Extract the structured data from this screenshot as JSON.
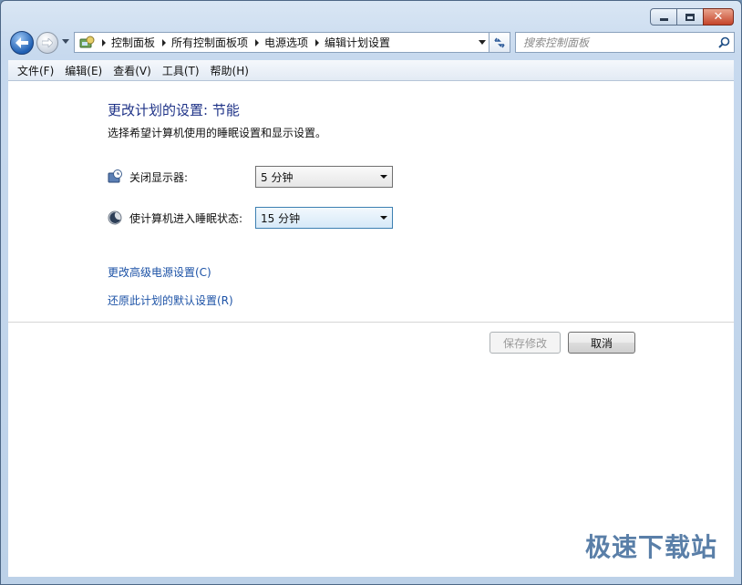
{
  "window": {
    "close_glyph": "✕"
  },
  "address_bar": {
    "breadcrumbs": [
      "控制面板",
      "所有控制面板项",
      "电源选项",
      "编辑计划设置"
    ],
    "icon": "control-panel-icon"
  },
  "search": {
    "placeholder": "搜索控制面板"
  },
  "menu": {
    "items": [
      "文件(F)",
      "编辑(E)",
      "查看(V)",
      "工具(T)",
      "帮助(H)"
    ]
  },
  "main": {
    "title": "更改计划的设置: 节能",
    "subtitle": "选择希望计算机使用的睡眠设置和显示设置。",
    "settings": [
      {
        "label": "关闭显示器:",
        "value": "5 分钟",
        "icon": "display-clock-icon"
      },
      {
        "label": "使计算机进入睡眠状态:",
        "value": "15 分钟",
        "icon": "sleep-moon-icon"
      }
    ],
    "links": {
      "advanced": "更改高级电源设置(C)",
      "restore": "还原此计划的默认设置(R)"
    },
    "buttons": {
      "save": "保存修改",
      "cancel": "取消"
    }
  },
  "watermark": "极速下载站",
  "colors": {
    "title": "#1e3287",
    "link": "#1c52a6",
    "frame": "#c7d9ee"
  }
}
